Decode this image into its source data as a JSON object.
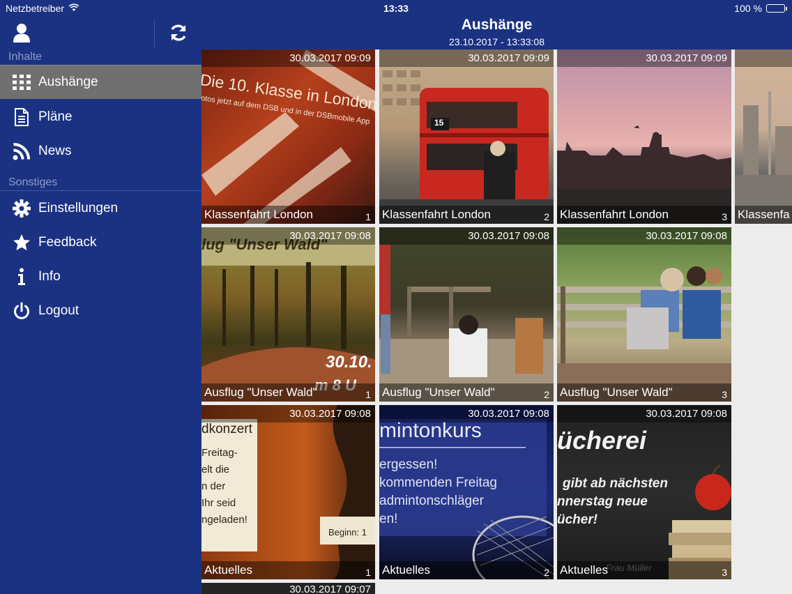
{
  "status": {
    "carrier": "Netzbetreiber",
    "time": "13:33",
    "battery": "100 %"
  },
  "sidebar": {
    "section_content": "Inhalte",
    "section_other": "Sonstiges",
    "items": [
      {
        "label": "Aushänge",
        "icon": "grid-icon"
      },
      {
        "label": "Pläne",
        "icon": "document-icon"
      },
      {
        "label": "News",
        "icon": "rss-icon"
      },
      {
        "label": "Einstellungen",
        "icon": "gear-icon"
      },
      {
        "label": "Feedback",
        "icon": "star-icon"
      },
      {
        "label": "Info",
        "icon": "info-icon"
      },
      {
        "label": "Logout",
        "icon": "power-icon"
      }
    ]
  },
  "header": {
    "title": "Aushänge",
    "subtitle": "23.10.2017 - 13:33:08"
  },
  "tiles": [
    {
      "timestamp": "30.03.2017 09:09",
      "caption": "Klassenfahrt London",
      "number": "1"
    },
    {
      "timestamp": "30.03.2017 09:09",
      "caption": "Klassenfahrt London",
      "number": "2"
    },
    {
      "timestamp": "30.03.2017 09:09",
      "caption": "Klassenfahrt London",
      "number": "3"
    },
    {
      "timestamp": "",
      "caption": "Klassenfa",
      "number": ""
    },
    {
      "timestamp": "30.03.2017 09:08",
      "caption": "Ausflug \"Unser Wald\"",
      "number": "1"
    },
    {
      "timestamp": "30.03.2017 09:08",
      "caption": "Ausflug \"Unser Wald\"",
      "number": "2"
    },
    {
      "timestamp": "30.03.2017 09:08",
      "caption": "Ausflug \"Unser Wald\"",
      "number": "3"
    },
    {
      "timestamp": "30.03.2017 09:08",
      "caption": "Aktuelles",
      "number": "1"
    },
    {
      "timestamp": "30.03.2017 09:08",
      "caption": "Aktuelles",
      "number": "2"
    },
    {
      "timestamp": "30.03.2017 09:08",
      "caption": "Aktuelles",
      "number": "3"
    },
    {
      "timestamp": "30.03.2017 09:07",
      "caption": "",
      "number": ""
    }
  ],
  "image_text": {
    "london1_line1": "Die 10. Klasse in London",
    "london1_line2": "otos jetzt auf dem DSB und in der DSBmobile App",
    "bus_sign": "15",
    "wald1_title": "lug \"Unser Wald\"",
    "wald1_date": "30.10.",
    "wald1_time": "m 8 U",
    "konzert_title": "dkonzert",
    "konzert_lines": [
      "Freitag-",
      "elt die",
      "n der",
      "Ihr seid",
      "ngeladen!"
    ],
    "konzert_begin": "Beginn: 1",
    "badminton_title": "mintonkurs",
    "badminton_lines": [
      "ergessen!",
      "kommenden Freitag",
      "admintonschläger",
      "en!"
    ],
    "buecherei_title": "ücherei",
    "buecherei_lines": [
      "gibt ab nächsten",
      "nnerstag neue",
      "ücher!"
    ],
    "buecherei_sign": "Frau Müller"
  },
  "colors": {
    "brand": "#1b3282",
    "active_item": "#707070"
  }
}
